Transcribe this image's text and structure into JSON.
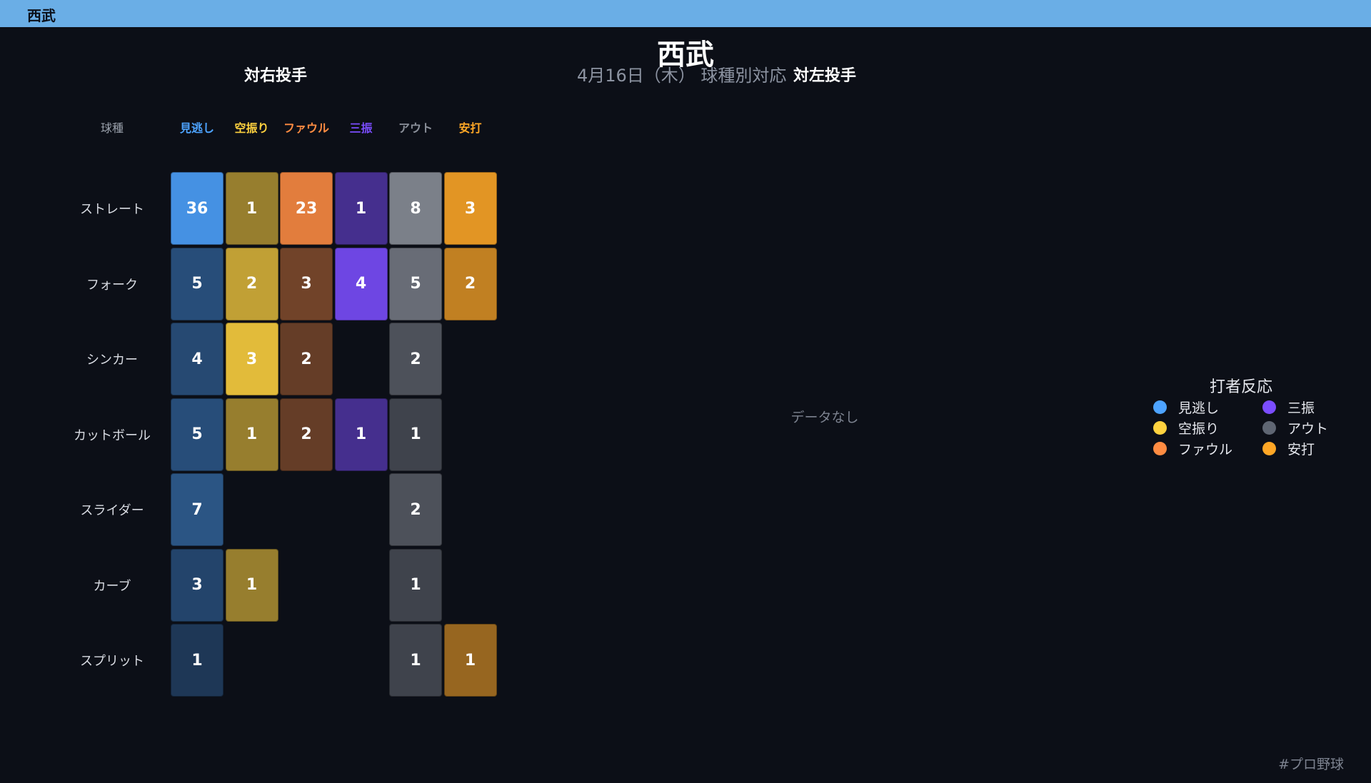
{
  "topbar": {
    "title": "西武"
  },
  "header": {
    "title": "西武",
    "subtitle": "4月16日（木） 球種別対応"
  },
  "panels": {
    "right": {
      "title": "対右投手"
    },
    "left": {
      "title": "対左投手",
      "empty_text": "データなし"
    }
  },
  "chart_data": {
    "type": "heatmap",
    "title": "対右投手",
    "row_header": "球種",
    "columns": [
      {
        "label": "見逃し",
        "color": "#4da3ff"
      },
      {
        "label": "空振り",
        "color": "#ffd23f"
      },
      {
        "label": "ファウル",
        "color": "#ff8c42"
      },
      {
        "label": "三振",
        "color": "#7b4dff"
      },
      {
        "label": "アウト",
        "color": "#8a8f99"
      },
      {
        "label": "安打",
        "color": "#ffa726"
      }
    ],
    "rows": [
      "ストレート",
      "フォーク",
      "シンカー",
      "カットボール",
      "スライダー",
      "カーブ",
      "スプリット"
    ],
    "values": [
      [
        36,
        1,
        23,
        1,
        8,
        3
      ],
      [
        5,
        2,
        3,
        4,
        5,
        2
      ],
      [
        4,
        3,
        2,
        null,
        2,
        null
      ],
      [
        5,
        1,
        2,
        1,
        1,
        null
      ],
      [
        7,
        null,
        null,
        null,
        2,
        null
      ],
      [
        3,
        1,
        null,
        null,
        1,
        null
      ],
      [
        1,
        null,
        null,
        null,
        1,
        1
      ]
    ]
  },
  "legend": {
    "title": "打者反応",
    "items": [
      {
        "label": "見逃し",
        "color": "#4da3ff"
      },
      {
        "label": "三振",
        "color": "#7b4dff"
      },
      {
        "label": "空振り",
        "color": "#ffd23f"
      },
      {
        "label": "アウト",
        "color": "#5f6673"
      },
      {
        "label": "ファウル",
        "color": "#ff8c42"
      },
      {
        "label": "安打",
        "color": "#ffa726"
      }
    ]
  },
  "footer": {
    "hashtag": "#プロ野球"
  }
}
